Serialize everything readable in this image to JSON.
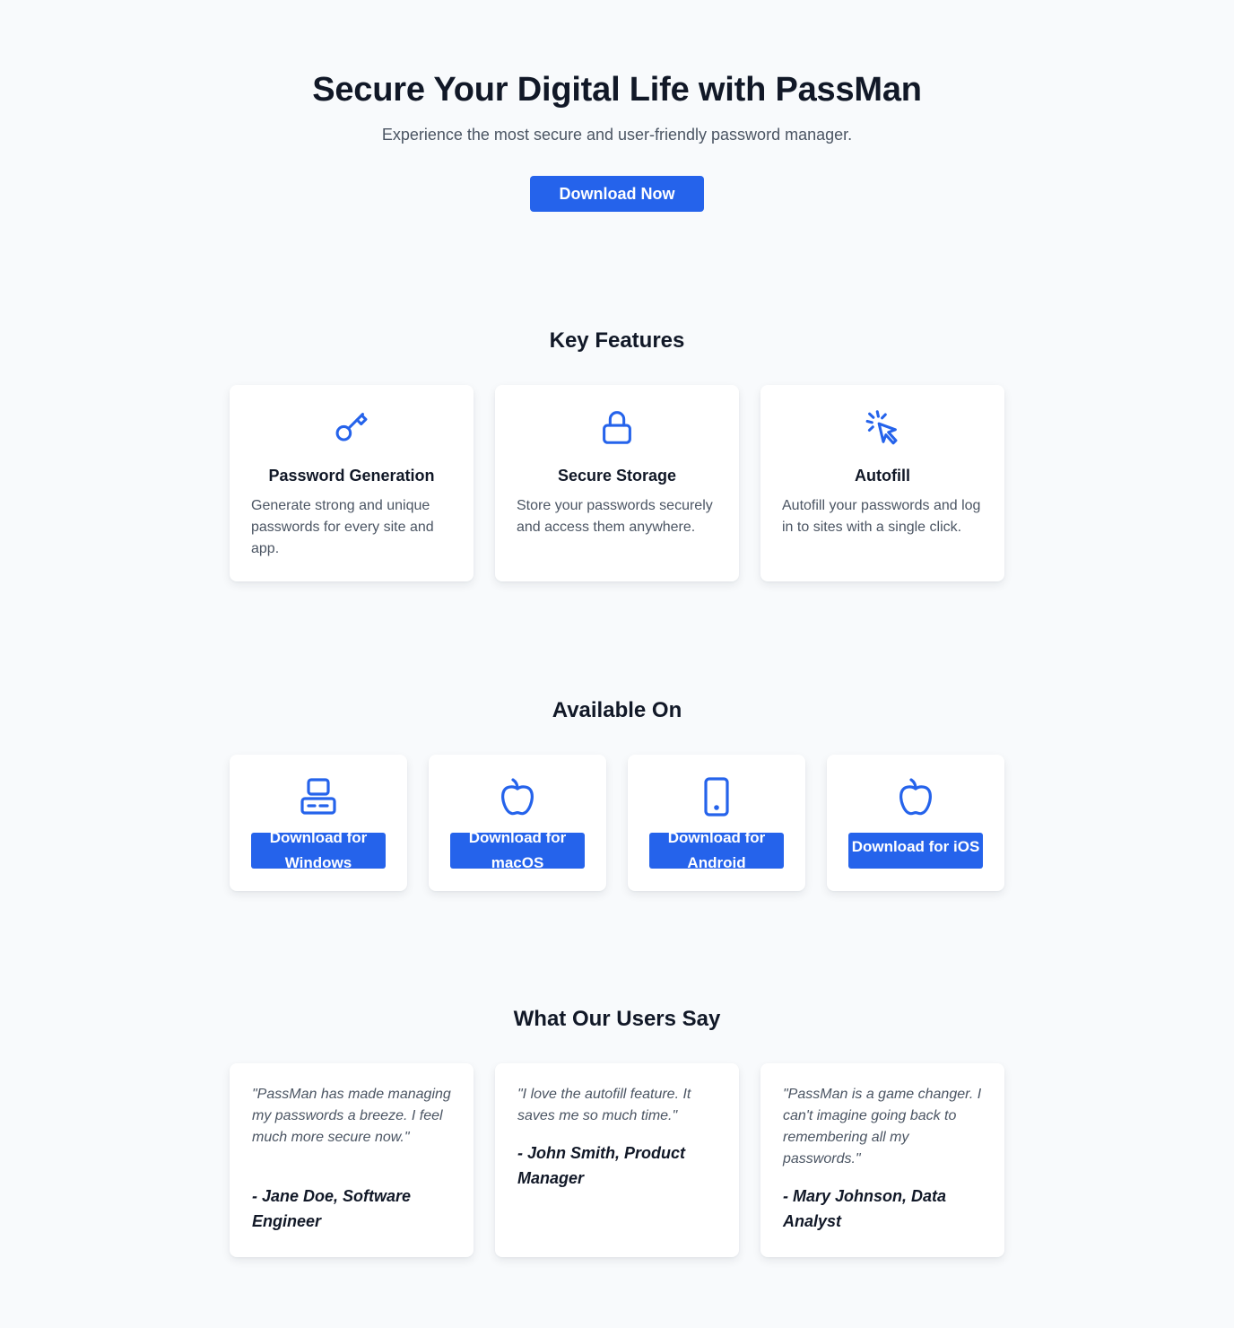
{
  "hero": {
    "title": "Secure Your Digital Life with PassMan",
    "subtitle": "Experience the most secure and user-friendly password manager.",
    "cta_label": "Download Now"
  },
  "features": {
    "title": "Key Features",
    "items": [
      {
        "icon": "key-icon",
        "title": "Password Generation",
        "description": "Generate strong and unique passwords for every site and app."
      },
      {
        "icon": "lock-icon",
        "title": "Secure Storage",
        "description": "Store your passwords securely and access them anywhere."
      },
      {
        "icon": "cursor-click-icon",
        "title": "Autofill",
        "description": "Autofill your passwords and log in to sites with a single click."
      }
    ]
  },
  "platforms": {
    "title": "Available On",
    "items": [
      {
        "icon": "desktop-icon",
        "button_label": "Download for Windows"
      },
      {
        "icon": "apple-icon",
        "button_label": "Download for macOS"
      },
      {
        "icon": "phone-icon",
        "button_label": "Download for Android"
      },
      {
        "icon": "apple-icon",
        "button_label": "Download for iOS"
      }
    ]
  },
  "testimonials": {
    "title": "What Our Users Say",
    "items": [
      {
        "quote": "\"PassMan has made managing my passwords a breeze. I feel much more secure now.\"",
        "author": "- Jane Doe, Software Engineer"
      },
      {
        "quote": "\"I love the autofill feature. It saves me so much time.\"",
        "author": "- John Smith, Product Manager"
      },
      {
        "quote": "\"PassMan is a game changer. I can't imagine going back to remembering all my passwords.\"",
        "author": "- Mary Johnson, Data Analyst"
      }
    ]
  },
  "colors": {
    "accent": "#2563eb",
    "background": "#f8fafc",
    "heading": "#111827",
    "body_text": "#4b5563"
  }
}
